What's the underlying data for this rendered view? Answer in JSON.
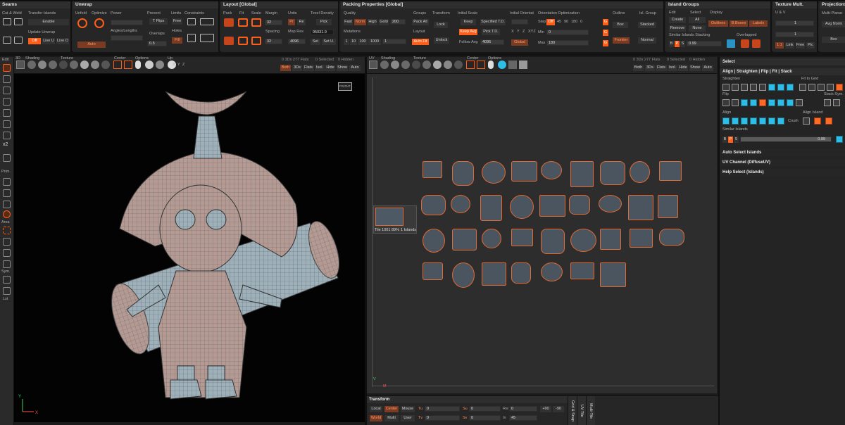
{
  "ribbon": {
    "seams": {
      "title": "Seams",
      "cut_weld": "Cut & Weld",
      "transfer": "Transfer Islands",
      "enable": "Enable",
      "update": "Update Unwrap",
      "off": "Off",
      "live_u": "Live U",
      "live_o": "Live O"
    },
    "unwrap": {
      "title": "Unwrap",
      "unfold": "Unfold",
      "optimize": "Optimize",
      "power": "Power",
      "prevent": "Prevent",
      "t_flips": "T Flips",
      "limits": "Limits",
      "constraints": "Constraints",
      "free": "Free",
      "angles": "Angles/Lengths",
      "overlaps": "Overlaps",
      "holes": "Holes",
      "fill": "Fill",
      "auto": "Auto",
      "val": "0.5"
    },
    "layout": {
      "title": "Layout [Global]",
      "pack": "Pack",
      "fit": "Fit",
      "scale": "Scale",
      "margin": "Margin",
      "units": "Units",
      "texel": "Texel Density",
      "margin_val": "32",
      "spacing": "Spacing",
      "map_res": "Map Res",
      "spacing_val": "32",
      "map_res_val": "4096",
      "pr": "Pr",
      "re": "Re",
      "pick": "Pick",
      "texel_val": "95031.9",
      "set": "Set",
      "set_u": "Set U."
    },
    "packing": {
      "title": "Packing Properties [Global]",
      "quality": "Quality",
      "fast": "Fast",
      "norm": "Norm",
      "high": "High",
      "gold": "Gold",
      "gold_val": "200",
      "groups": "Groups",
      "pack_all": "Pack All",
      "transform": "Transform",
      "lock": "Lock",
      "mutations": "Mutations",
      "m1": "1",
      "m2": "10",
      "m3": "100",
      "m4": "1000",
      "m5": "1",
      "layout": "Layout",
      "auto_fit": "Auto Fit",
      "unlock": "Unlock",
      "initial_scale": "Initial Scale",
      "keep": "Keep",
      "specified_td": "Specified T.D.",
      "keep_avg": "Keep Avg",
      "pick_td": "Pick T.D.",
      "follow_avg": "Follow Avg",
      "follow_val": "4096",
      "initial_orient": "Initial Orientat",
      "ox": "X",
      "oy": "Y",
      "oz": "Z",
      "oxyz": "XYZ",
      "global": "Global",
      "orient_opt": "Orientation Optimization",
      "step": "Step",
      "step_off": "Off",
      "s45": "45",
      "s90": "90",
      "s180": "180",
      "s0": "0",
      "min": "Min",
      "min_val": "0",
      "max": "Max",
      "max_val": "180",
      "outline": "Outline",
      "box": "Box",
      "frontier": "Frontier",
      "isl_group": "Isl. Group",
      "stacked": "Stacked",
      "normal": "Normal"
    },
    "island_groups": {
      "title": "Island Groups",
      "edit": "Edit",
      "select": "Select",
      "display": "Display",
      "create": "Create",
      "all": "All",
      "outlines": "Outlines",
      "bboxes": "B.Boxes",
      "labels": "Labels",
      "remove": "Remove",
      "none": "None",
      "similar": "Similar Islands Stacking",
      "overlapped": "Overlapped",
      "b": "B",
      "p": "P",
      "s": "S",
      "sim_val": "0.99"
    },
    "texture_mult": {
      "title": "Texture Mult.",
      "uv": "U & V",
      "u_val": "1",
      "v_val": "1",
      "ratio": "1:1",
      "link": "Link",
      "free": "Free",
      "pic": "Pic"
    },
    "projections": {
      "title": "Projections",
      "multi": "Multi-Planar",
      "avg": "Avg Norm",
      "box": "Box"
    }
  },
  "viewport3d": {
    "toolbar": {
      "label_3d": "3D",
      "shading": "Shading",
      "texture": "Texture",
      "center": "Center",
      "options": "Options",
      "up": "Up",
      "x": "X",
      "y": "Y",
      "z": "Z"
    },
    "status": "0 3Ds 277 Flats",
    "selected": "0 Selected",
    "hidden": "0 Hidden",
    "modes": [
      "Both",
      "3Ds",
      "Flats",
      "Isol.",
      "Hide",
      "Show",
      "Auto"
    ],
    "axis_x": "X",
    "axis_y": "Y",
    "cube": "FRONT"
  },
  "viewportuv": {
    "toolbar": {
      "uv": "UV",
      "shading": "Shading",
      "texture": "Texture",
      "center": "Center",
      "options": "Options"
    },
    "status": "0 3Ds 277 Flats",
    "selected": "0 Selected",
    "hidden": "0 Hidden",
    "modes": [
      "Both",
      "3Ds",
      "Flats",
      "Isol.",
      "Hide",
      "Show",
      "Auto"
    ],
    "tile": "Tile 1001 89%",
    "islands_label": "1 Islands",
    "axis_u": "V",
    "axis_m": "M"
  },
  "left_tools": {
    "edit": "Edit",
    "prim": "Prim.",
    "area": "Area",
    "sym": "Sym.",
    "x2": "x2",
    "lst": "Lst"
  },
  "right_panel": {
    "select": "Select",
    "tabs": "Align | Straighten | Flip | Fit | Stack",
    "straighten": "Straighten",
    "fit_grid": "Fit to Grid",
    "flip": "Flip",
    "stack_sym": "Stack Sym.",
    "align": "Align",
    "align_island": "Align Island",
    "crush": "Crush",
    "similar": "Similar Islands",
    "sim_val": "0.99",
    "b": "B",
    "p": "P",
    "s": "S",
    "auto_select": "Auto Select Islands",
    "uv_channel": "UV Channel (DiffuseUV)",
    "help_select": "Help Select (Islands)"
  },
  "transform": {
    "title": "Transform",
    "local": "Local",
    "center": "Center",
    "mouse": "Mouse",
    "world": "World",
    "multi": "Multi",
    "user": "User",
    "tu": "Tu",
    "tv": "Tv",
    "tu_val": "0",
    "tv_val": "0",
    "su": "Su",
    "sv": "Sv",
    "su_val": "0",
    "sv_val": "0",
    "rw": "Rw",
    "rw_val": "0",
    "in": "In",
    "in_val": "45",
    "r90": "+90",
    "rm90": "-90",
    "vtabs": [
      "Grid & Snap",
      "UV Tile",
      "Multi-Tile"
    ]
  },
  "colors": {
    "accent": "#ff5e1a",
    "cyan": "#2dbde6",
    "bg": "#1b1b1b"
  }
}
